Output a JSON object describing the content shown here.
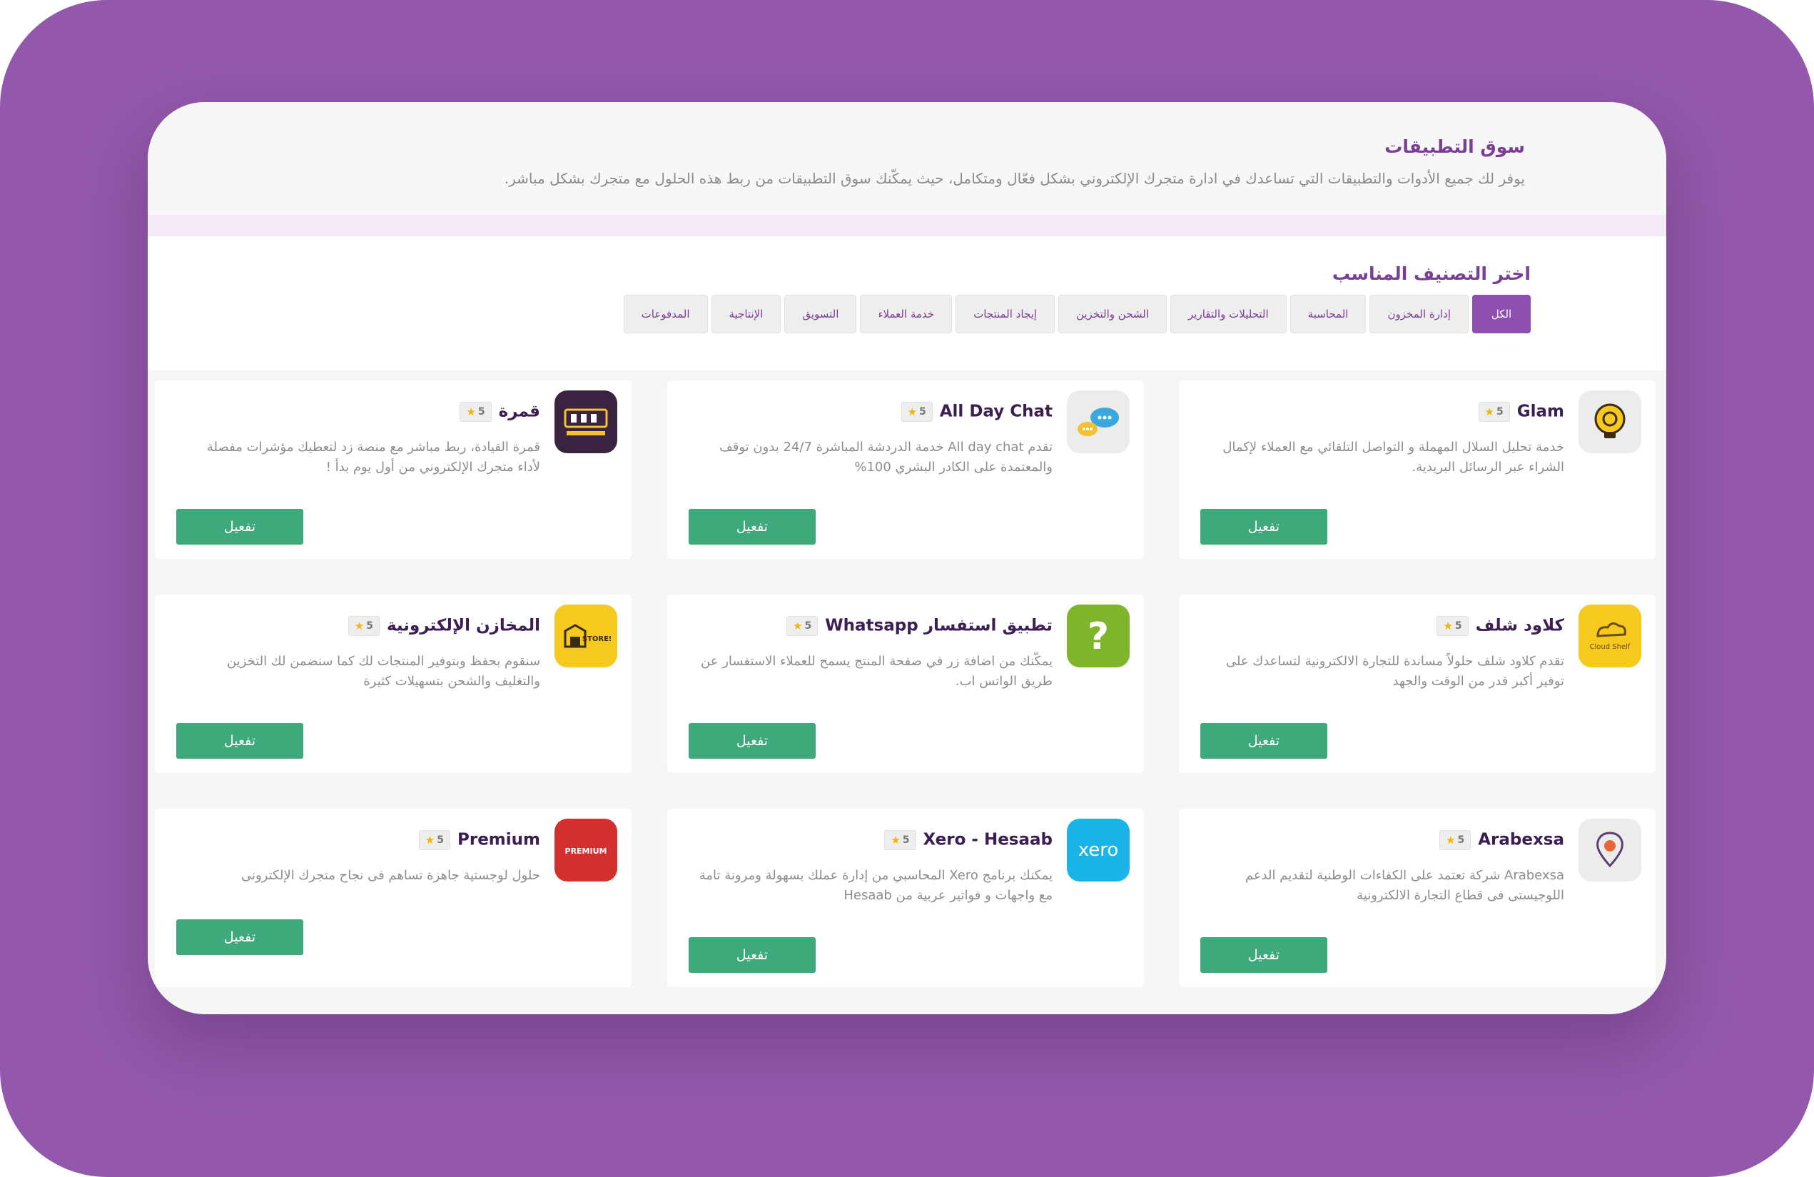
{
  "header": {
    "title": "سوق التطبيقات",
    "description": "يوفر لك جميع الأدوات والتطبيقات التي تساعدك في ادارة متجرك الإلكتروني بشكل فعّال ومتكامل، حيث يمكّنك سوق التطبيقات من ربط هذه الحلول مع متجرك بشكل مباشر."
  },
  "category": {
    "title": "اختر التصنيف المناسب",
    "tabs": [
      "الكل",
      "إدارة المخزون",
      "المحاسبة",
      "التحليلات والتقارير",
      "الشحن والتخزين",
      "إيجاد المنتجات",
      "خدمة العملاء",
      "التسويق",
      "الإنتاجية",
      "المدفوعات"
    ]
  },
  "apps": [
    {
      "name": "Glam",
      "rating": "5",
      "logo_icon": "lightbulb-icon",
      "description": "خدمة تحليل السلال المهملة و التواصل التلقائي مع العملاء لإكمال الشراء عبر الرسائل البريدية.",
      "button": "تفعيل"
    },
    {
      "name": "All Day Chat",
      "rating": "5",
      "logo_icon": "chat-bubbles-icon",
      "description": "تقدم All day chat خدمة الدردشة المباشرة 24/7 بدون توقف والمعتمدة على الكادر البشري 100%",
      "button": "تفعيل"
    },
    {
      "name": "قمرة",
      "rating": "5",
      "logo_icon": "qumra-logo",
      "description": "قمرة القيادة، ربط مباشر مع منصة زد لتعطيك مؤشرات مفصلة لأداء متجرك الإلكتروني من أول يوم بدأ !",
      "button": "تفعيل"
    },
    {
      "name": "كلاود شلف",
      "rating": "5",
      "logo_icon": "cloud-shelf-logo",
      "logo_text": "Cloud Shelf",
      "description": "تقدم كلاود شلف حلولاً مساندة للتجارة الالكترونية لتساعدك على توفير أكبر قدر من الوقت والجهد",
      "button": "تفعيل"
    },
    {
      "name": "تطبيق استفسار Whatsapp",
      "rating": "5",
      "logo_icon": "question-mark-icon",
      "description": "يمكّنك من اضافة زر في صفحة المنتج يسمح للعملاء الاستفسار عن طريق الواتس اب.",
      "button": "تفعيل"
    },
    {
      "name": "المخازن الإلكترونية",
      "rating": "5",
      "logo_icon": "warehouse-logo",
      "logo_text": "STORES",
      "description": "سنقوم بحفظ وبتوفير المنتجات لك كما سنضمن لك التخزين والتغليف والشحن بتسهيلات كثيرة",
      "button": "تفعيل"
    },
    {
      "name": "Arabexsa",
      "rating": "5",
      "logo_icon": "map-pin-icon",
      "description": "Arabexsa شركة تعتمد على الكفاءات الوطنية لتقديم الدعم اللوجيستى فى قطاع التجارة الالكترونية",
      "button": "تفعيل"
    },
    {
      "name": "Xero - Hesaab",
      "rating": "5",
      "logo_icon": "xero-logo",
      "logo_text": "xero",
      "description": "يمكنك برنامج Xero المحاسبي من إدارة عملك بسهولة ومرونة تامة مع واجهات و فواتير عربية من Hesaab",
      "button": "تفعيل"
    },
    {
      "name": "Premium",
      "rating": "5",
      "logo_icon": "premium-logo",
      "logo_text": "PREMIUM",
      "description": "حلول لوجستية جاهزة تساهم فى نجاح متجرك الإلكترونى",
      "button": "تفعيل"
    }
  ]
}
